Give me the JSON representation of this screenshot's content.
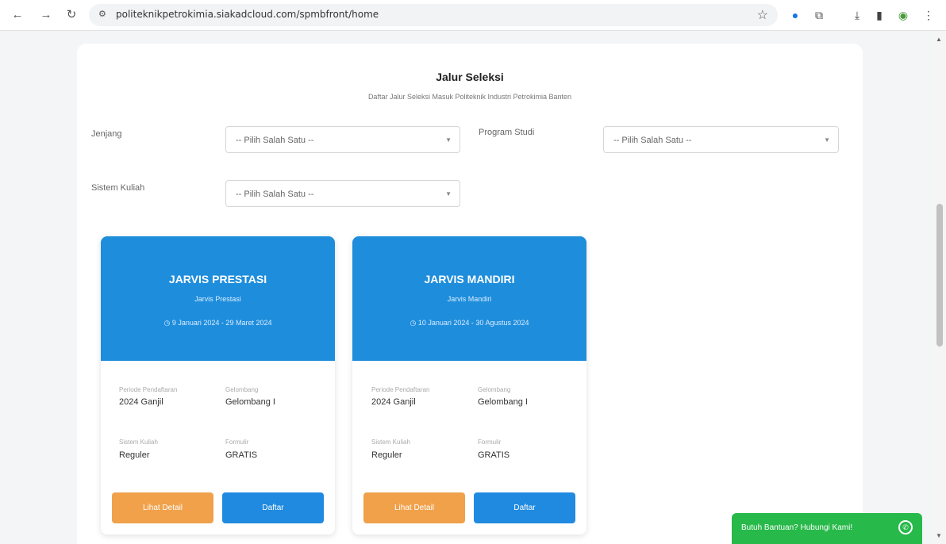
{
  "browser": {
    "url": "politeknikpetrokimia.siakadcloud.com/spmbfront/home"
  },
  "page": {
    "title": "Jalur Seleksi",
    "subtitle": "Daftar Jalur Seleksi Masuk Politeknik Industri Petrokimia Banten"
  },
  "filters": {
    "jenjang": {
      "label": "Jenjang",
      "value": "-- Pilih Salah Satu --"
    },
    "program_studi": {
      "label": "Program Studi",
      "value": "-- Pilih Salah Satu --"
    },
    "sistem_kuliah": {
      "label": "Sistem Kuliah",
      "value": "-- Pilih Salah Satu --"
    }
  },
  "jalur": [
    {
      "name": "JARVIS PRESTASI",
      "subname": "Jarvis Prestasi",
      "date": "9 Januari 2024 - 29 Maret 2024",
      "periode_label": "Periode Pendaftaran",
      "periode_value": "2024 Ganjil",
      "gelombang_label": "Gelombang",
      "gelombang_value": "Gelombang I",
      "sistem_label": "Sistem Kuliah",
      "sistem_value": "Reguler",
      "formulir_label": "Formulir",
      "formulir_value": "GRATIS",
      "detail_label": "Lihat Detail",
      "daftar_label": "Daftar"
    },
    {
      "name": "JARVIS MANDIRI",
      "subname": "Jarvis Mandiri",
      "date": "10 Januari 2024 - 30 Agustus 2024",
      "periode_label": "Periode Pendaftaran",
      "periode_value": "2024 Ganjil",
      "gelombang_label": "Gelombang",
      "gelombang_value": "Gelombang I",
      "sistem_label": "Sistem Kuliah",
      "sistem_value": "Reguler",
      "formulir_label": "Formulir",
      "formulir_value": "GRATIS",
      "detail_label": "Lihat Detail",
      "daftar_label": "Daftar"
    }
  ],
  "help": {
    "label": "Butuh Bantuan? Hubungi Kami!"
  },
  "colors": {
    "primary": "#1e8ddc",
    "detail": "#f0a14a",
    "help": "#27b94a"
  }
}
